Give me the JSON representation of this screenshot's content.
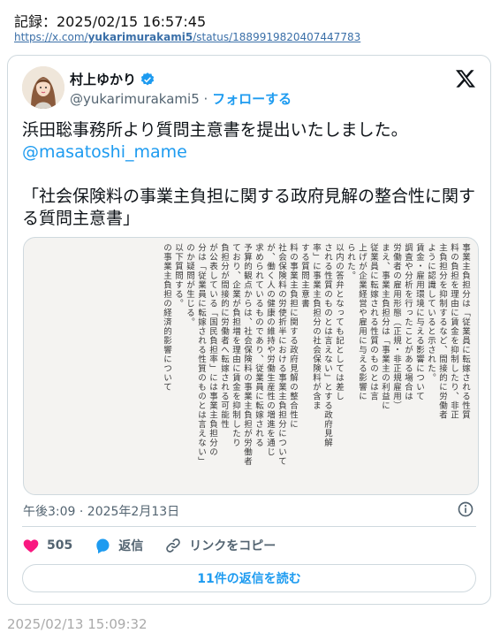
{
  "record": {
    "label": "記録：2025/02/15 16:57:45",
    "url_prefix": "https://x.com/",
    "url_user": "yukarimurakami5",
    "url_suffix": "/status/1889919820407447783"
  },
  "tweet": {
    "author_name": "村上ゆかり",
    "author_handle": "@yukarimurakami5",
    "separator": "·",
    "follow_label": "フォローする",
    "text_line1": "浜田聡事務所より質問主意書を提出いたしました。",
    "mention": "@masatoshi_mame",
    "text_line3": "「社会保険料の事業主負担に関する政府見解の整合性に関する質問主意書」",
    "timestamp": "午後3:09 · 2025年2月13日",
    "like_count": "505",
    "reply_label": "返信",
    "copy_link_label": "リンクをコピー",
    "read_replies_label": "11件の返信を読む"
  },
  "document_image": {
    "columns": [
      "事業主負担分は「従業員に転嫁される性質",
      "料の負担を理由に賃金を抑制したり、非正",
      "主負担分を抑制するなど、間接的に労働者",
      "ように認識していると示された。",
      "賃金・雇用環境に与える影響について",
      "調査や分析を行ったことがある場合は",
      "労働者の雇用形態（正規・非正規雇用）",
      "まえ、事業主負担分は「事業主の利益に",
      "従業員に転嫁される性質のものとは言",
      "上げが企業経営や雇用に与える影響に",
      "られた。",
      "以内の答弁となっても記としては差し",
      "される性質のものとは言えない」とする政府見解",
      "率」に事業主負担分の社会保険料が含ま",
      "する質問主意書",
      "料の事業主負担に関する政府見解の整合性に",
      "社会保険料の労使折半における事業主負担分について",
      "が、働く人の健康の維持や労働生産性の増進を通じ",
      "求められているものであり、従業員に転嫁される",
      "予算的観点からは、社会保険料の事業主負担が労働者",
      "ており、企業が負担増を理由に賃金を抑制したり",
      "負担分が間接的に労働者へ転嫁される可能性",
      "が公表している「国民負担率」には事業主負担分の",
      "分は「従業員に転嫁される性質のものとは言えない」",
      "のか疑問が生じる。",
      "以下質問する。",
      "の事業主負担の経済的影響について"
    ]
  },
  "colors": {
    "accent": "#1d9bf0",
    "like": "#f91880",
    "muted": "#536471",
    "border": "#cfd9de"
  },
  "footer": {
    "time": "2025/02/13 15:09:32"
  }
}
